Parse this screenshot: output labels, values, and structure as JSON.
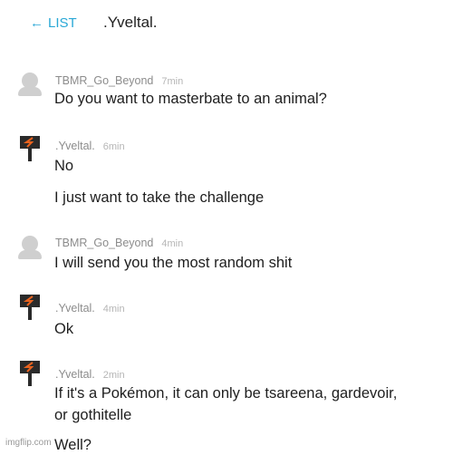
{
  "header": {
    "back_arrow": "←",
    "back_label": "LIST",
    "title": ".Yveltal."
  },
  "messages": [
    {
      "user": "TBMR_Go_Beyond",
      "time": "7min",
      "avatar": "default-avatar-icon",
      "lines": [
        "Do you want to masterbate to an animal?"
      ]
    },
    {
      "user": ".Yveltal.",
      "time": "6min",
      "avatar": "yveltal-avatar-icon",
      "lines": [
        "No",
        "I just want to take the challenge"
      ]
    },
    {
      "user": "TBMR_Go_Beyond",
      "time": "4min",
      "avatar": "default-avatar-icon",
      "lines": [
        "I will send you the most random shit"
      ]
    },
    {
      "user": ".Yveltal.",
      "time": "4min",
      "avatar": "yveltal-avatar-icon",
      "lines": [
        "Ok"
      ]
    },
    {
      "user": ".Yveltal.",
      "time": "2min",
      "avatar": "yveltal-avatar-icon",
      "lines": [
        "If it's a Pokémon, it can only be tsareena, gardevoir,",
        "or gothitelle",
        "Well?"
      ]
    }
  ],
  "watermark": "imgflip.com",
  "colors": {
    "accent": "#29a8d6",
    "avatar_default": "#cfcfcf",
    "avatar_dark": "#2a2a2a",
    "avatar_orange": "#e8621e"
  }
}
